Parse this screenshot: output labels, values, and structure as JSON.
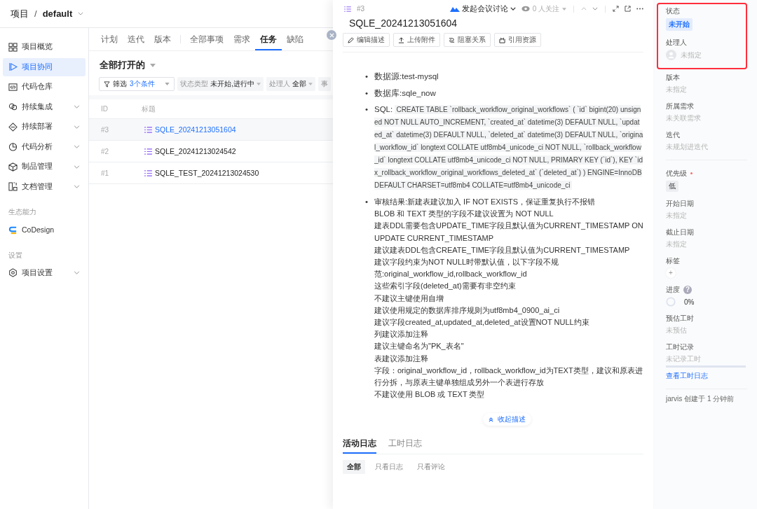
{
  "header": {
    "project_label": "项目",
    "separator": "/",
    "project_name": "default"
  },
  "nav": [
    {
      "kind": "item",
      "label": "项目概览",
      "expandable": false,
      "selected": false
    },
    {
      "kind": "item",
      "label": "项目协同",
      "expandable": false,
      "selected": true
    },
    {
      "kind": "item",
      "label": "代码仓库",
      "expandable": false,
      "selected": false
    },
    {
      "kind": "item",
      "label": "持续集成",
      "expandable": true,
      "selected": false
    },
    {
      "kind": "item",
      "label": "持续部署",
      "expandable": true,
      "selected": false
    },
    {
      "kind": "item",
      "label": "代码分析",
      "expandable": true,
      "selected": false
    },
    {
      "kind": "item",
      "label": "制品管理",
      "expandable": true,
      "selected": false
    },
    {
      "kind": "item",
      "label": "文档管理",
      "expandable": true,
      "selected": false
    },
    {
      "kind": "section",
      "label": "生态能力"
    },
    {
      "kind": "item",
      "label": "CoDesign",
      "expandable": false,
      "selected": false
    },
    {
      "kind": "section",
      "label": "设置"
    },
    {
      "kind": "item",
      "label": "项目设置",
      "expandable": true,
      "selected": false
    }
  ],
  "tab_groups": [
    [
      {
        "label": "计划",
        "selected": false
      },
      {
        "label": "迭代",
        "selected": false
      },
      {
        "label": "版本",
        "selected": false
      }
    ],
    [
      {
        "label": "全部事项",
        "selected": false
      },
      {
        "label": "需求",
        "selected": false
      },
      {
        "label": "任务",
        "selected": true
      },
      {
        "label": "缺陷",
        "selected": false
      }
    ]
  ],
  "view": {
    "title": "全部打开的"
  },
  "filter": {
    "label": "筛选",
    "count": "3个条件"
  },
  "chips": [
    {
      "label": "状态类型",
      "value": "未开始,进行中"
    },
    {
      "label": "处理人",
      "value": "全部"
    },
    {
      "label": "事"
    }
  ],
  "table": {
    "columns": [
      "ID",
      "标题"
    ],
    "rows": [
      {
        "id": "#3",
        "title": "SQLE_20241213051604",
        "selected": true
      },
      {
        "id": "#2",
        "title": "SQLE_20241213024542",
        "selected": false
      },
      {
        "id": "#1",
        "title": "SQLE_TEST_20241213024530",
        "selected": false
      }
    ]
  },
  "drawer": {
    "number": "#3",
    "meeting": "发起会议讨论",
    "watchers": "0 人关注",
    "title": "SQLE_20241213051604",
    "actions": [
      "编辑描述",
      "上传附件",
      "阻塞关系",
      "引用资源"
    ],
    "description": [
      {
        "kind": "text",
        "bullet": "•",
        "text": "数据源:test-mysql"
      },
      {
        "kind": "text",
        "bullet": "•",
        "text": "数据库:sqle_now"
      },
      {
        "kind": "code",
        "bullet": "•",
        "label": "SQL:",
        "code": "CREATE TABLE `rollback_workflow_original_workflows` ( `id` bigint(20) unsigned NOT NULL AUTO_INCREMENT, `created_at` datetime(3) DEFAULT NULL, `updated_at` datetime(3) DEFAULT NULL, `deleted_at` datetime(3) DEFAULT NULL, `original_workflow_id` longtext COLLATE utf8mb4_unicode_ci NOT NULL, `rollback_workflow_id` longtext COLLATE utf8mb4_unicode_ci NOT NULL, PRIMARY KEY (`id`), KEY `idx_rollback_workflow_original_workflows_deleted_at` (`deleted_at`) ) ENGINE=InnoDB DEFAULT CHARSET=utf8mb4 COLLATE=utf8mb4_unicode_ci"
      },
      {
        "kind": "lines",
        "bullet": "•",
        "lines": [
          "审核结果:新建表建议加入 IF NOT EXISTS，保证重复执行不报错",
          "BLOB 和 TEXT 类型的字段不建议设置为 NOT NULL",
          "建表DDL需要包含UPDATE_TIME字段且默认值为CURRENT_TIMESTAMP ON UPDATE CURRENT_TIMESTAMP",
          "建议建表DDL包含CREATE_TIME字段且默认值为CURRENT_TIMESTAMP",
          "建议字段约束为NOT NULL时带默认值，以下字段不规范:original_workflow_id,rollback_workflow_id",
          "这些索引字段(deleted_at)需要有非空约束",
          "不建议主键使用自增",
          "建议使用规定的数据库排序规则为utf8mb4_0900_ai_ci",
          "建议字段created_at,updated_at,deleted_at设置NOT NULL约束",
          "列建议添加注释",
          "建议主键命名为\"PK_表名\"",
          "表建议添加注释",
          "字段：original_workflow_id，rollback_workflow_id为TEXT类型，建议和原表进行分拆，与原表主键单独组成另外一个表进行存放",
          "不建议使用 BLOB 或 TEXT 类型"
        ]
      }
    ],
    "collapse": "收起描述",
    "log_tabs": [
      {
        "label": "活动日志",
        "selected": true
      },
      {
        "label": "工时日志",
        "selected": false
      }
    ],
    "log_filters": [
      {
        "label": "全部",
        "selected": true
      },
      {
        "label": "只看日志",
        "selected": false
      },
      {
        "label": "只看评论",
        "selected": false
      }
    ]
  },
  "details": {
    "sections": [
      {
        "highlighted": true,
        "divided": false,
        "fields": [
          {
            "kind": "status",
            "label": "状态",
            "value": "未开始"
          },
          {
            "kind": "user",
            "label": "处理人",
            "placeholder": "未指定"
          }
        ]
      },
      {
        "highlighted": false,
        "divided": false,
        "fields": [
          {
            "kind": "text",
            "label": "版本",
            "placeholder": "未指定"
          },
          {
            "kind": "text",
            "label": "所属需求",
            "placeholder": "未关联需求"
          },
          {
            "kind": "text",
            "label": "迭代",
            "placeholder": "未规划进迭代"
          }
        ]
      },
      {
        "highlighted": false,
        "divided": true,
        "fields": [
          {
            "kind": "tag",
            "label": "优先级",
            "required": true,
            "value": "低"
          },
          {
            "kind": "text",
            "label": "开始日期",
            "placeholder": "未指定"
          },
          {
            "kind": "text",
            "label": "截止日期",
            "placeholder": "未指定"
          },
          {
            "kind": "add",
            "label": "标签",
            "value": "+"
          },
          {
            "kind": "progress",
            "label": "进度",
            "help": "?",
            "value": "0%"
          },
          {
            "kind": "text",
            "label": "预估工时",
            "placeholder": "未预估"
          },
          {
            "kind": "timelog",
            "label": "工时记录",
            "placeholder": "未记录工时",
            "link": "查看工时日志"
          }
        ]
      }
    ],
    "footer": "jarvis 创建于 1 分钟前"
  }
}
